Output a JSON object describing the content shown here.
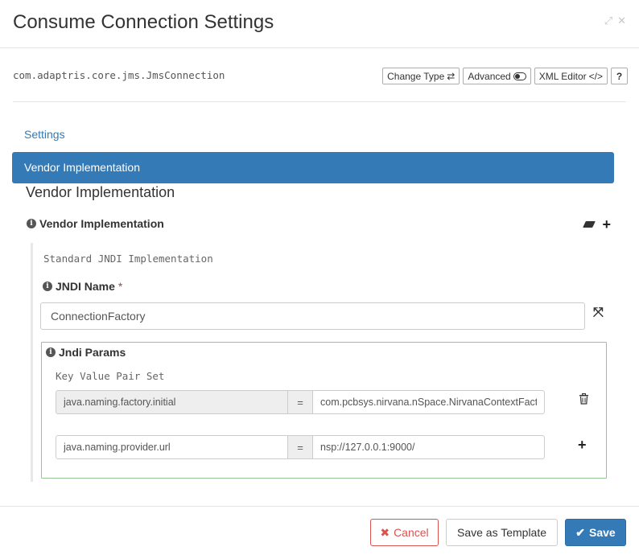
{
  "header": {
    "title": "Consume Connection Settings"
  },
  "toolbar": {
    "class_name": "com.adaptris.core.jms.JmsConnection",
    "change_type_label": "Change Type",
    "advanced_label": "Advanced",
    "xml_editor_label": "XML Editor",
    "help_label": "?"
  },
  "nav": {
    "settings_label": "Settings",
    "active_label": "Vendor Implementation"
  },
  "section": {
    "title": "Vendor Implementation",
    "field_label": "Vendor Implementation",
    "implementation_name": "Standard JNDI Implementation"
  },
  "jndi_name": {
    "label": "JNDI Name",
    "required_marker": "*",
    "value": "ConnectionFactory"
  },
  "jndi_params": {
    "label": "Jndi Params",
    "set_title": "Key Value Pair Set",
    "rows": [
      {
        "key": "java.naming.factory.initial",
        "equals": "=",
        "value": "com.pcbsys.nirvana.nSpace.NirvanaContextFactory"
      },
      {
        "key": "java.naming.provider.url",
        "equals": "=",
        "value": "nsp://127.0.0.1:9000/"
      }
    ]
  },
  "footer": {
    "cancel_label": "Cancel",
    "template_label": "Save as Template",
    "save_label": "Save"
  },
  "colors": {
    "primary": "#337ab7",
    "danger": "#d9534f",
    "success_border": "#98c493"
  }
}
